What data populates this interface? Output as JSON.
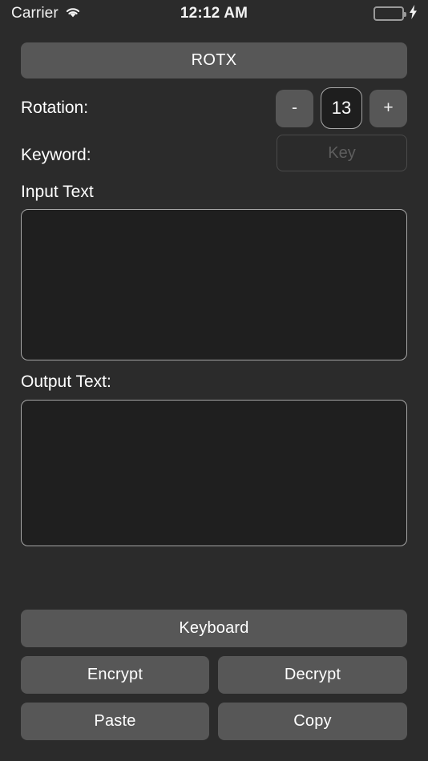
{
  "status_bar": {
    "carrier": "Carrier",
    "wifi_icon": "wifi-icon",
    "time": "12:12 AM",
    "battery_icon": "battery-icon",
    "battery_color": "#4ed464",
    "charging_icon": "lightning-bolt-icon"
  },
  "app": {
    "title": "ROTX"
  },
  "rotation": {
    "label": "Rotation:",
    "decrement_label": "-",
    "value": "13",
    "increment_label": "+"
  },
  "keyword": {
    "label": "Keyword:",
    "value": "",
    "placeholder": "Key"
  },
  "input_text": {
    "label": "Input Text",
    "value": ""
  },
  "output_text": {
    "label": "Output Text:",
    "value": ""
  },
  "actions": {
    "keyboard": "Keyboard",
    "encrypt": "Encrypt",
    "decrypt": "Decrypt",
    "paste": "Paste",
    "copy": "Copy"
  },
  "colors": {
    "background": "#2b2b2b",
    "button_fill": "#575757",
    "field_fill": "#1f1f1f",
    "field_border": "#a5a5a5",
    "text": "#ffffff",
    "placeholder": "#5e5e5e"
  }
}
